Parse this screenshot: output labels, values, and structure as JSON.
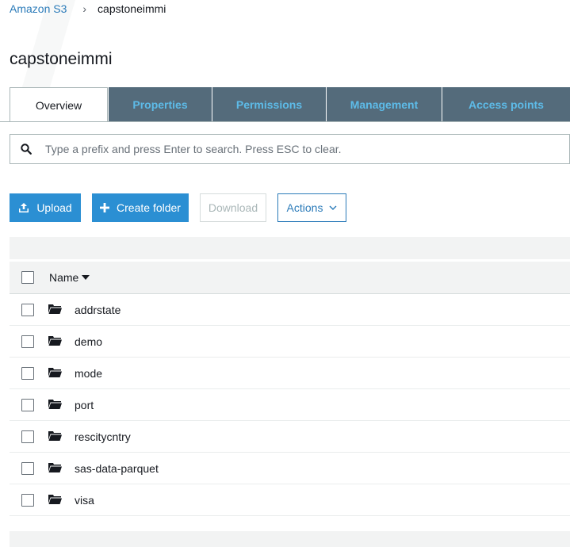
{
  "breadcrumb": {
    "root": "Amazon S3",
    "current": "capstoneimmi"
  },
  "page": {
    "title": "capstoneimmi"
  },
  "tabs": [
    {
      "label": "Overview",
      "active": true
    },
    {
      "label": "Properties",
      "active": false
    },
    {
      "label": "Permissions",
      "active": false
    },
    {
      "label": "Management",
      "active": false
    },
    {
      "label": "Access points",
      "active": false
    }
  ],
  "search": {
    "placeholder": "Type a prefix and press Enter to search. Press ESC to clear.",
    "value": ""
  },
  "toolbar": {
    "upload_label": "Upload",
    "create_folder_label": "Create folder",
    "download_label": "Download",
    "actions_label": "Actions"
  },
  "table": {
    "name_header": "Name",
    "rows": [
      {
        "name": "addrstate",
        "type": "folder"
      },
      {
        "name": "demo",
        "type": "folder"
      },
      {
        "name": "mode",
        "type": "folder"
      },
      {
        "name": "port",
        "type": "folder"
      },
      {
        "name": "rescitycntry",
        "type": "folder"
      },
      {
        "name": "sas-data-parquet",
        "type": "folder"
      },
      {
        "name": "visa",
        "type": "folder"
      }
    ]
  },
  "colors": {
    "accent": "#2b8fd3",
    "link": "#2b7bb9",
    "tab_bg": "#546b7b",
    "tab_text": "#5dbbe8"
  },
  "icons": {
    "search": "search-icon",
    "upload": "upload-icon",
    "create_folder": "plus-icon",
    "actions": "chevron-down-icon",
    "sort": "sort-desc-icon",
    "folder": "folder-open-icon"
  }
}
